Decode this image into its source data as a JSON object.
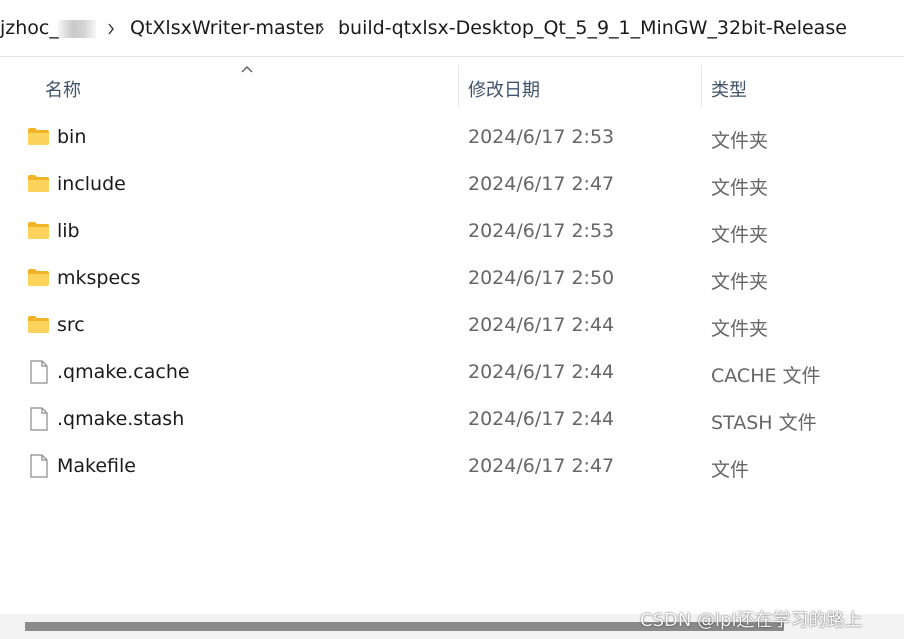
{
  "breadcrumb": {
    "partial": "jzhoc_",
    "item1": "QtXlsxWriter-master",
    "item2": "build-qtxlsx-Desktop_Qt_5_9_1_MinGW_32bit-Release"
  },
  "columns": {
    "name": "名称",
    "date": "修改日期",
    "type": "类型"
  },
  "rows": [
    {
      "name": "bin",
      "date": "2024/6/17 2:53",
      "type": "文件夹",
      "icon": "folder-icon"
    },
    {
      "name": "include",
      "date": "2024/6/17 2:47",
      "type": "文件夹",
      "icon": "folder-icon"
    },
    {
      "name": "lib",
      "date": "2024/6/17 2:53",
      "type": "文件夹",
      "icon": "folder-icon"
    },
    {
      "name": "mkspecs",
      "date": "2024/6/17 2:50",
      "type": "文件夹",
      "icon": "folder-icon"
    },
    {
      "name": "src",
      "date": "2024/6/17 2:44",
      "type": "文件夹",
      "icon": "folder-icon"
    },
    {
      "name": ".qmake.cache",
      "date": "2024/6/17 2:44",
      "type": "CACHE 文件",
      "icon": "file-icon"
    },
    {
      "name": ".qmake.stash",
      "date": "2024/6/17 2:44",
      "type": "STASH 文件",
      "icon": "file-icon"
    },
    {
      "name": "Makefile",
      "date": "2024/6/17 2:47",
      "type": "文件",
      "icon": "file-icon"
    }
  ],
  "watermark": "CSDN @lpl还在学习的路上",
  "colors": {
    "folder": "#f8c93f",
    "header_text": "#40536b",
    "secondary_text": "#666666"
  }
}
